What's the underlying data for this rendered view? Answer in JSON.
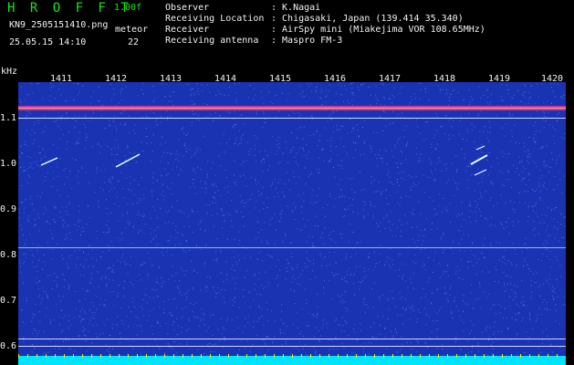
{
  "header": {
    "app_title": "H R O F F T",
    "version": "1.00f",
    "filename": "KN9_2505151410.png",
    "meteor_label": "meteor",
    "datetime": "25.05.15 14:10",
    "meteor_count": "22",
    "info": [
      {
        "label": "Observer",
        "value": ": K.Nagai"
      },
      {
        "label": "Receiving Location",
        "value": ": Chigasaki, Japan (139.414 35.340)"
      },
      {
        "label": "Receiver",
        "value": ": AirSpy mini (Miakejima VOR 108.65MHz)"
      },
      {
        "label": "Receiving antenna",
        "value": ": Maspro FM-3"
      }
    ]
  },
  "spectrogram": {
    "y_unit": "kHz",
    "y_ticks": [
      "1.1",
      "1.0",
      "0.9",
      "0.8",
      "0.7",
      "0.6"
    ],
    "x_ticks": [
      "1411",
      "1412",
      "1413",
      "1414",
      "1415",
      "1416",
      "1417",
      "1418",
      "1419",
      "1420"
    ],
    "colors": {
      "background": "#1a33b3",
      "noise": "#5aa0ff",
      "carrier": "#ff3399",
      "line": "#e6e6ff",
      "meteor": "#e6ffff",
      "bottom_band": "#00e5ff",
      "tick": "#ffee00"
    }
  }
}
